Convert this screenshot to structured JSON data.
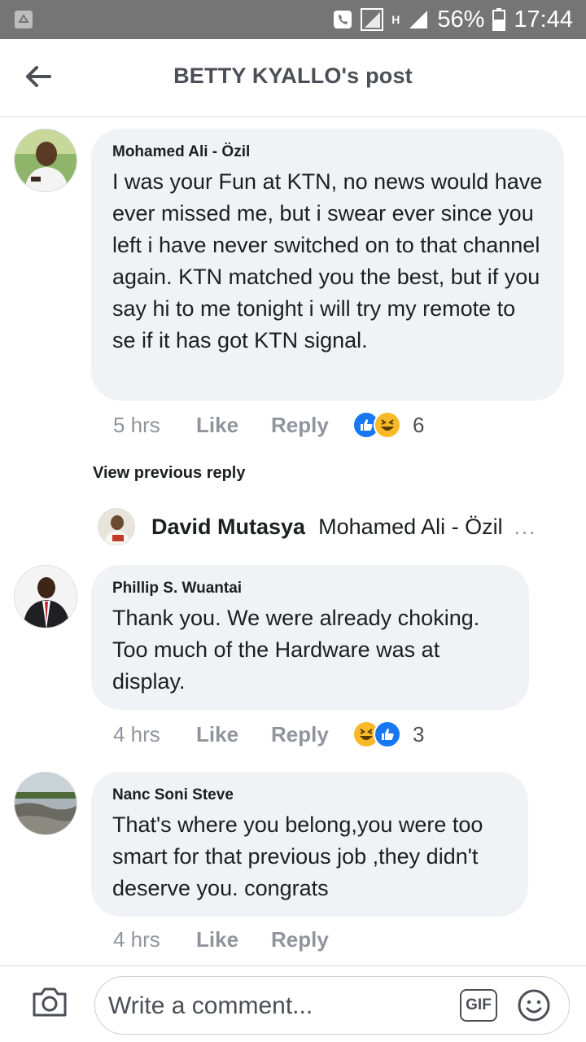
{
  "status_bar": {
    "battery": "56%",
    "time": "17:44",
    "network": "H"
  },
  "header": {
    "title": "BETTY KYALLO's post"
  },
  "comments": [
    {
      "author": "Mohamed Ali - Özil",
      "text": "I was your Fun at KTN, no news would have ever missed me, but i swear ever since you left i have never switched on to that channel again. KTN matched you the best, but if you say hi to me tonight i will try my remote to se if it has got KTN signal.",
      "time": "5 hrs",
      "like_label": "Like",
      "reply_label": "Reply",
      "reactions": [
        "like",
        "haha"
      ],
      "reaction_count": "6"
    },
    {
      "author": "Phillip S. Wuantai",
      "text": "Thank you.  We were already choking. Too much of the Hardware was at display.",
      "time": "4 hrs",
      "like_label": "Like",
      "reply_label": "Reply",
      "reactions": [
        "haha",
        "like"
      ],
      "reaction_count": "3"
    },
    {
      "author": "Nanc Soni Steve",
      "text": "That's where you belong,you were too smart for that previous job ,they didn't deserve you. congrats",
      "time": "4 hrs",
      "like_label": "Like",
      "reply_label": "Reply"
    }
  ],
  "view_previous_reply": "View previous reply",
  "reply_preview": {
    "author": "David Mutasya",
    "snippet": "Mohamed Ali - Özil",
    "more": "..."
  },
  "composer": {
    "placeholder": "Write a comment...",
    "gif_label": "GIF"
  },
  "colors": {
    "bubble": "#f0f2f5",
    "like_blue": "#1877f2",
    "haha_yellow": "#f7b928",
    "status_bar": "#757575"
  }
}
